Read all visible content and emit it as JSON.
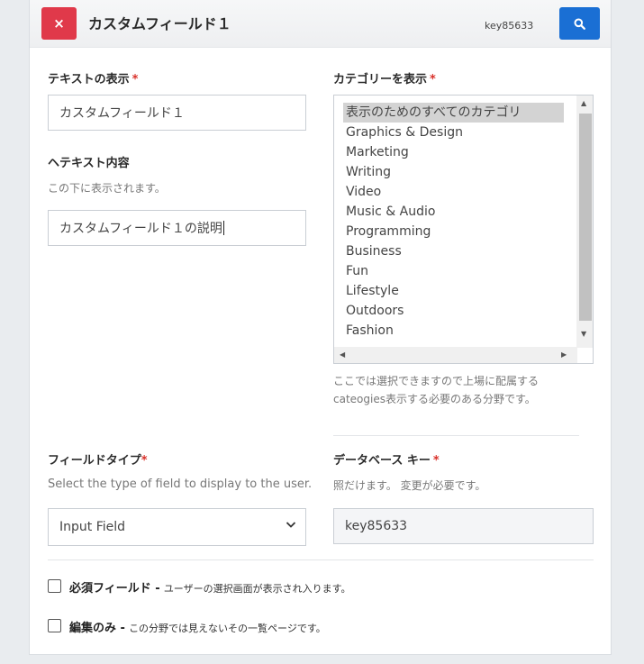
{
  "header": {
    "title": "カスタムフィールド１",
    "key_label": "key85633",
    "close_symbol": "×"
  },
  "display_text": {
    "label": "テキストの表示",
    "required_mark": "*",
    "value": "カスタムフィールド１"
  },
  "help_text": {
    "label": "ヘテキスト内容",
    "help": "この下に表示されます。",
    "value": "カスタムフィールド１の説明"
  },
  "categories": {
    "label": "カテゴリーを表示",
    "required_mark": "*",
    "items": [
      {
        "label": "表示のためのすべてのカテゴリ",
        "selected": true
      },
      {
        "label": "Graphics & Design"
      },
      {
        "label": "Marketing"
      },
      {
        "label": "Writing"
      },
      {
        "label": "Video"
      },
      {
        "label": "Music & Audio"
      },
      {
        "label": "Programming"
      },
      {
        "label": "Business"
      },
      {
        "label": "Fun"
      },
      {
        "label": "Lifestyle"
      },
      {
        "label": "Outdoors"
      },
      {
        "label": "Fashion"
      }
    ],
    "help_line1": "ここでは選択できますので上場に配属する",
    "help_line2": "cateogies表示する必要のある分野です。"
  },
  "field_type": {
    "label": "フィールドタイプ",
    "required_mark": "*",
    "help": "Select the type of field to display to the user.",
    "value": "Input Field"
  },
  "db_key": {
    "label": "データベース キー",
    "required_mark": "*",
    "help": "照だけます。 変更が必要です。",
    "value": "key85633"
  },
  "required_field": {
    "title": "必須フィールド -",
    "desc": "ユーザーの選択画面が表示され入ります。",
    "checked": false
  },
  "edit_only": {
    "title": "編集のみ -",
    "desc": "この分野では見えないその一覧ページです。",
    "checked": false
  },
  "colors": {
    "close_button": "#e0394a",
    "search_button": "#1a6fd4",
    "required": "#d9312a"
  }
}
